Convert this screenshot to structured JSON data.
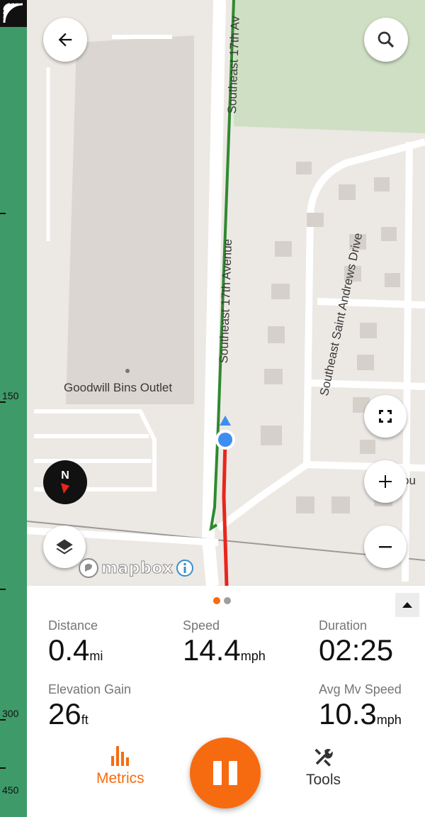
{
  "elevation_strip": {
    "labels": [
      "150",
      "300",
      "450"
    ]
  },
  "map": {
    "labels": {
      "poi": "Goodwill Bins Outlet",
      "street_17th_top": "Southeast 17th Av",
      "street_17th_mid": "Southeast 17th Avenue",
      "street_saint_andrews": "Southeast Saint Andrews Drive",
      "street_cutoff": "ou"
    },
    "attribution": "mapbox",
    "colors": {
      "route_planned": "#2f8a2f",
      "route_recorded": "#e8261c",
      "location_dot": "#3d8ef0",
      "park": "#cfdfc3"
    },
    "icons": {
      "back": "arrow-left-icon",
      "search": "search-icon",
      "fullscreen": "fullscreen-icon",
      "zoom_in": "plus-icon",
      "zoom_out": "minus-icon",
      "layers": "layers-icon",
      "compass": "compass-icon",
      "compass_letter": "N"
    }
  },
  "panel": {
    "page_indicator": {
      "count": 2,
      "active": 0
    },
    "metrics": [
      {
        "label": "Distance",
        "value": "0.4",
        "unit": "mi"
      },
      {
        "label": "Speed",
        "value": "14.4",
        "unit": "mph"
      },
      {
        "label": "Duration",
        "value": "02:25",
        "unit": ""
      },
      {
        "label": "Elevation Gain",
        "value": "26",
        "unit": "ft"
      },
      {
        "label": "Avg Mv Speed",
        "value": "10.3",
        "unit": "mph"
      }
    ],
    "nav": {
      "metrics_label": "Metrics",
      "tools_label": "Tools"
    },
    "accent_color": "#f76b10"
  }
}
